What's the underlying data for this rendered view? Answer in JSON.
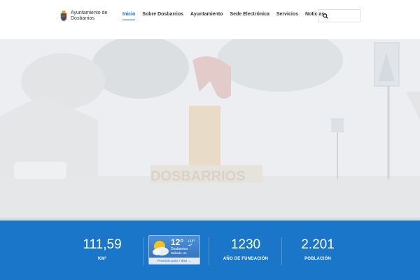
{
  "header": {
    "logo_line1": "Ayuntamiento de",
    "logo_line2": "Dosbarrios",
    "nav": [
      "Inicio",
      "Sobre Dosbarrios",
      "Ayuntamiento",
      "Sede Electrónica",
      "Servicios",
      "Noticias"
    ],
    "active_nav": "Inicio"
  },
  "hero": {
    "sculpture_text": "DOSBARRIOS"
  },
  "stats": {
    "area_value": "111,59",
    "area_label": "KM²",
    "founding_value": "1230",
    "founding_label": "AÑO DE FUNDACIÓN",
    "population_value": "2.201",
    "population_label": "POBLACIÓN"
  },
  "weather": {
    "temp": "12°",
    "range": "+14° -4°",
    "city": "Dosbarrios",
    "date": "Sábado, 21",
    "forecast_link": "Previsión para 7 días →"
  },
  "colors": {
    "accent": "#1565c0",
    "stats_bg": "#1976c8"
  }
}
